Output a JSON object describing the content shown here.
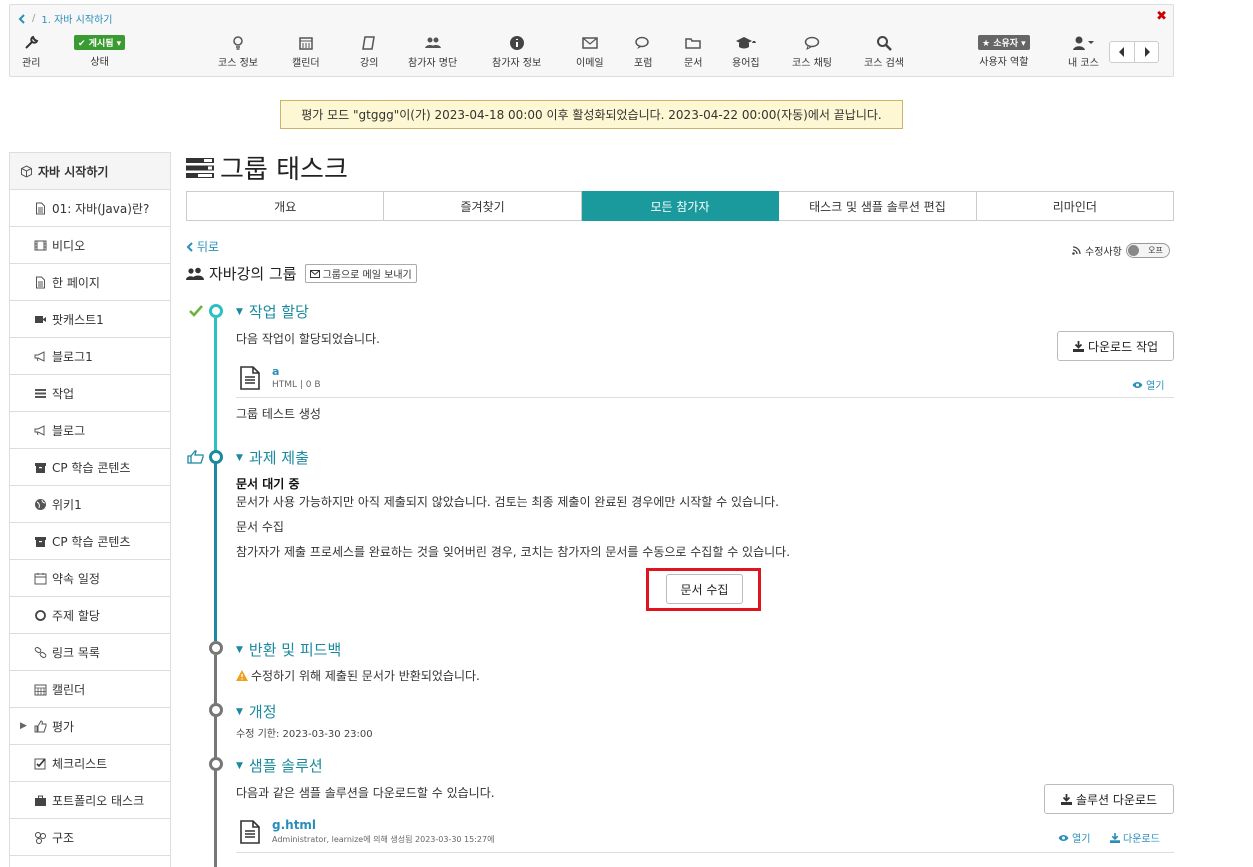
{
  "breadcrumb": {
    "item": "1. 자바 시작하기"
  },
  "toolbar": {
    "manage": "관리",
    "status_badge": "✔ 게시됨 ▾",
    "status": "상태",
    "items": [
      "코스 정보",
      "캘린더",
      "강의",
      "참가자 명단",
      "참가자 정보",
      "이메일",
      "포럼",
      "문서",
      "용어집",
      "코스 채팅",
      "코스 검색"
    ],
    "owner_badge": "★ 소유자 ▾",
    "user_role": "사용자 역할",
    "my_courses": "내 코스"
  },
  "notice": "평가 모드 \"gtggg\"이(가) 2023-04-18 00:00 이후 활성화되었습니다. 2023-04-22 00:00(자동)에서 끝납니다.",
  "sidebar": {
    "root": "자바 시작하기",
    "items": [
      {
        "label": "01: 자바(Java)란?",
        "icon": "document-icon"
      },
      {
        "label": "비디오",
        "icon": "film-icon"
      },
      {
        "label": "한 페이지",
        "icon": "document-icon"
      },
      {
        "label": "팟캐스트1",
        "icon": "camera-icon"
      },
      {
        "label": "블로그1",
        "icon": "bullhorn-icon"
      },
      {
        "label": "작업",
        "icon": "tasks-icon"
      },
      {
        "label": "블로그",
        "icon": "bullhorn-icon"
      },
      {
        "label": "CP 학습 콘텐츠",
        "icon": "archive-icon"
      },
      {
        "label": "위키1",
        "icon": "globe-icon"
      },
      {
        "label": "CP 학습 콘텐츠",
        "icon": "archive-icon"
      },
      {
        "label": "약속 일정",
        "icon": "calendar-icon"
      },
      {
        "label": "주제 할당",
        "icon": "circle-icon"
      },
      {
        "label": "링크 목록",
        "icon": "link-icon"
      },
      {
        "label": "캘린더",
        "icon": "calendar-grid-icon"
      },
      {
        "label": "평가",
        "icon": "thumbs-up-icon"
      },
      {
        "label": "체크리스트",
        "icon": "checkbox-icon"
      },
      {
        "label": "포트폴리오 태스크",
        "icon": "briefcase-icon"
      },
      {
        "label": "구조",
        "icon": "sitemap-icon"
      }
    ]
  },
  "page_title": "그룹 태스크",
  "tabs": [
    "개요",
    "즐겨찾기",
    "모든 참가자",
    "태스크 및 샘플 솔루션 편집",
    "리마인더"
  ],
  "active_tab": 2,
  "back": "뒤로",
  "changes_label": "수정사항",
  "toggle_label": "오프",
  "group": {
    "name": "자바강의 그룹",
    "mail_button": "그룹으로 메일 보내기"
  },
  "steps": {
    "assignment": {
      "title": "작업 할당",
      "desc": "다음 작업이 할당되었습니다.",
      "download_button": "다운로드 작업",
      "file_name": "a",
      "file_meta": "HTML | 0 B",
      "open": "열기",
      "note": "그룹 테스트 생성"
    },
    "submission": {
      "title": "과제 제출",
      "waiting_title": "문서 대기 중",
      "waiting_desc": "문서가 사용 가능하지만 아직 제출되지 않았습니다. 검토는 최종 제출이 완료된 경우에만 시작할 수 있습니다.",
      "collect_title": "문서 수집",
      "collect_desc": "참가자가 제출 프로세스를 완료하는 것을 잊어버린 경우, 코치는 참가자의 문서를 수동으로 수집할 수 있습니다.",
      "collect_button": "문서 수집"
    },
    "feedback": {
      "title": "반환 및 피드백",
      "warning": "수정하기 위해 제출된 문서가 반환되었습니다."
    },
    "revision": {
      "title": "개정",
      "deadline": "수정 기한: 2023-03-30 23:00"
    },
    "solution": {
      "title": "샘플 솔루션",
      "desc": "다음과 같은 샘플 솔루션을 다운로드할 수 있습니다.",
      "download_button": "솔루션 다운로드",
      "file_name": "g.html",
      "file_meta": "Administrator, learnize에 의해 생성됨 2023-03-30 15:27에",
      "open": "열기",
      "download": "다운로드"
    }
  },
  "colors": {
    "accent": "#1b9a9e",
    "link": "#2a8fb8",
    "highlight": "#e0141e",
    "check": "#6cb33e",
    "warning": "#f0a020"
  }
}
